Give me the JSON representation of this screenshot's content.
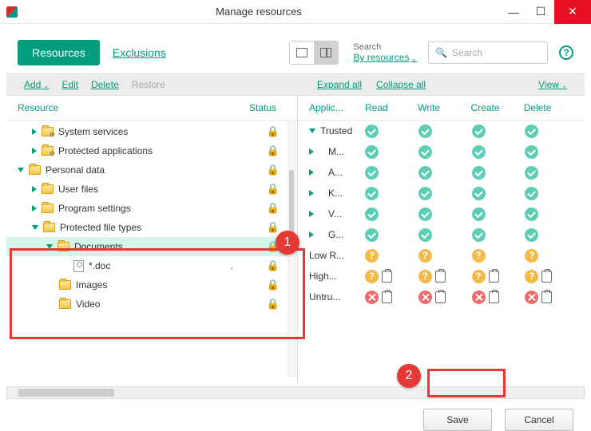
{
  "window": {
    "title": "Manage resources"
  },
  "tabs": {
    "resources": "Resources",
    "exclusions": "Exclusions"
  },
  "search": {
    "label": "Search",
    "mode": "By resources",
    "placeholder": "Search"
  },
  "actions": {
    "add": "Add",
    "edit": "Edit",
    "delete": "Delete",
    "restore": "Restore",
    "expand": "Expand all",
    "collapse": "Collapse all",
    "view": "View"
  },
  "left_headers": {
    "resource": "Resource",
    "status": "Status"
  },
  "right_headers": {
    "app": "Applic...",
    "read": "Read",
    "write": "Write",
    "create": "Create",
    "delete": "Delete"
  },
  "tree": [
    {
      "label": "System services",
      "indent": 1,
      "tri": "right",
      "icon": "folder-gear"
    },
    {
      "label": "Protected applications",
      "indent": 1,
      "tri": "right",
      "icon": "folder-gear"
    },
    {
      "label": "Personal data",
      "indent": 0,
      "tri": "down",
      "icon": "folder"
    },
    {
      "label": "User files",
      "indent": 1,
      "tri": "right",
      "icon": "folder"
    },
    {
      "label": "Program settings",
      "indent": 1,
      "tri": "right",
      "icon": "folder"
    },
    {
      "label": "Protected file types",
      "indent": 1,
      "tri": "down",
      "icon": "folder"
    },
    {
      "label": "Documents",
      "indent": 2,
      "tri": "down",
      "icon": "folder",
      "selected": true
    },
    {
      "label": "*.doc",
      "indent": 3,
      "tri": "none",
      "icon": "file",
      "extra": "."
    },
    {
      "label": "Images",
      "indent": 2,
      "tri": "none",
      "icon": "folder"
    },
    {
      "label": "Video",
      "indent": 2,
      "tri": "none",
      "icon": "folder"
    }
  ],
  "perms": [
    {
      "name": "Trusted",
      "indent": 0,
      "tri": "down",
      "cells": [
        "check",
        "check",
        "check",
        "check"
      ]
    },
    {
      "name": "M...",
      "indent": 1,
      "tri": "right",
      "cells": [
        "check",
        "check",
        "check",
        "check"
      ]
    },
    {
      "name": "A...",
      "indent": 1,
      "tri": "right",
      "cells": [
        "check",
        "check",
        "check",
        "check"
      ]
    },
    {
      "name": "K...",
      "indent": 1,
      "tri": "right",
      "cells": [
        "check",
        "check",
        "check",
        "check"
      ]
    },
    {
      "name": "V...",
      "indent": 1,
      "tri": "right",
      "cells": [
        "check",
        "check",
        "check",
        "check"
      ]
    },
    {
      "name": "G...",
      "indent": 1,
      "tri": "right",
      "cells": [
        "check",
        "check",
        "check",
        "check"
      ]
    },
    {
      "name": "Low R...",
      "indent": 0,
      "tri": "none",
      "cells": [
        "q",
        "q",
        "q",
        "q"
      ]
    },
    {
      "name": "High...",
      "indent": 0,
      "tri": "none",
      "cells": [
        "q clip",
        "q clip",
        "q clip",
        "q clip"
      ]
    },
    {
      "name": "Untru...",
      "indent": 0,
      "tri": "none",
      "cells": [
        "x clip",
        "x clip",
        "x clip",
        "x clip"
      ]
    }
  ],
  "footer": {
    "save": "Save",
    "cancel": "Cancel"
  },
  "annot": {
    "b1": "1",
    "b2": "2"
  }
}
